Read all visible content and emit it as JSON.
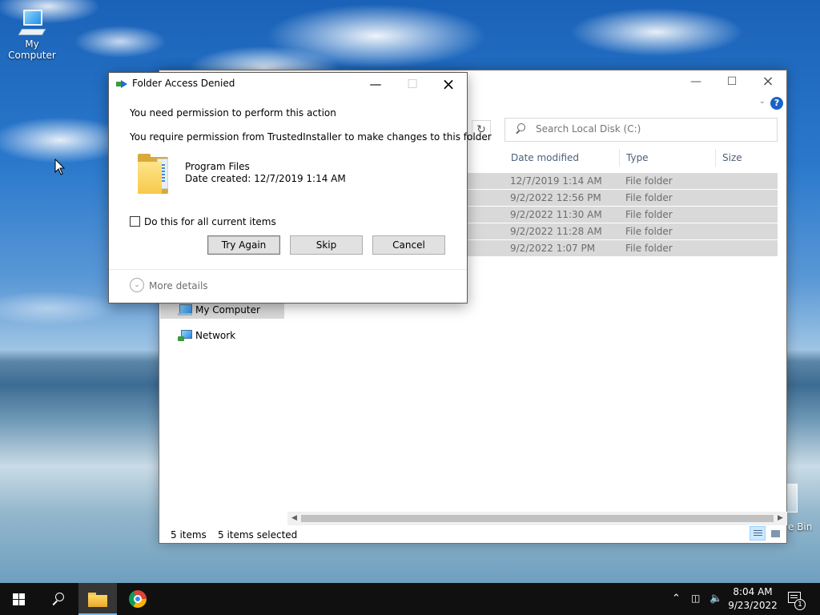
{
  "desktop": {
    "icons": [
      {
        "label": "My Computer"
      },
      {
        "label": "e Bin"
      }
    ]
  },
  "explorer": {
    "search": {
      "placeholder": "Search Local Disk (C:)"
    },
    "columns": [
      "Date modified",
      "Type",
      "Size"
    ],
    "rows": [
      {
        "date": "12/7/2019 1:14 AM",
        "type": "File folder"
      },
      {
        "date": "9/2/2022 12:56 PM",
        "type": "File folder"
      },
      {
        "date": "9/2/2022 11:30 AM",
        "type": "File folder"
      },
      {
        "date": "9/2/2022 11:28 AM",
        "type": "File folder"
      },
      {
        "date": "9/2/2022 1:07 PM",
        "type": "File folder"
      }
    ],
    "nav": [
      {
        "label": "My Computer"
      },
      {
        "label": "Network"
      }
    ],
    "status": {
      "count": "5 items",
      "selected": "5 items selected"
    }
  },
  "dialog": {
    "title": "Folder Access Denied",
    "message": "You need permission to perform this action",
    "detail": "You require permission from TrustedInstaller to make changes to this folder",
    "item_name": "Program Files",
    "item_date": "Date created: 12/7/2019 1:14 AM",
    "checkbox_label": "Do this for all current items",
    "buttons": {
      "try_again": "Try Again",
      "skip": "Skip",
      "cancel": "Cancel"
    },
    "more_details": "More details"
  },
  "taskbar": {
    "time": "8:04 AM",
    "date": "9/23/2022",
    "notification_count": "1"
  }
}
